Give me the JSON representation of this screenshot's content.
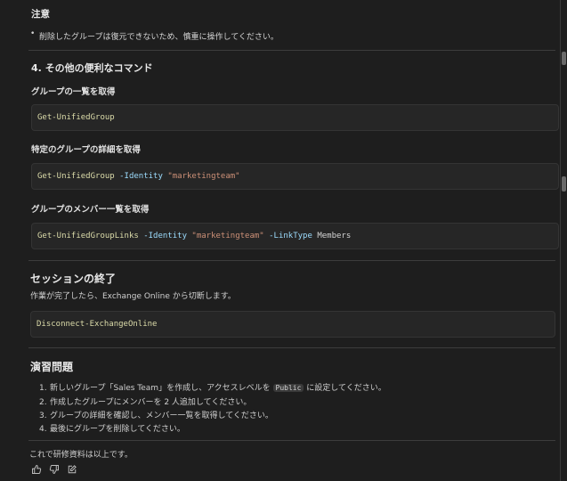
{
  "note": {
    "title": "注意",
    "bullet": "削除したグループは復元できないため、慎重に操作してください。"
  },
  "section4": {
    "heading": "4. その他の便利なコマンド",
    "list_heading": "グループの一覧を取得",
    "list_code": {
      "cmd": "Get-UnifiedGroup"
    },
    "detail_heading": "特定のグループの詳細を取得",
    "detail_code": {
      "cmd": "Get-UnifiedGroup",
      "param": "-Identity",
      "value": "\"marketingteam\""
    },
    "members_heading": "グループのメンバー一覧を取得",
    "members_code": {
      "cmd": "Get-UnifiedGroupLinks",
      "param": "-Identity",
      "value": "\"marketingteam\"",
      "param2": "-LinkType",
      "value2": "Members"
    }
  },
  "session_end": {
    "heading": "セッションの終了",
    "text": "作業が完了したら、Exchange Online から切断します。",
    "code": {
      "cmd": "Disconnect-ExchangeOnline"
    }
  },
  "exercises": {
    "heading": "演習問題",
    "items": [
      {
        "num": "1.",
        "text_before": "新しいグループ「Sales Team」を作成し、アクセスレベルを",
        "code": "Public",
        "text_after": "に設定してください。"
      },
      {
        "num": "2.",
        "text": "作成したグループにメンバーを 2 人追加してください。"
      },
      {
        "num": "3.",
        "text": "グループの詳細を確認し、メンバー一覧を取得してください。"
      },
      {
        "num": "4.",
        "text": "最後にグループを削除してください。"
      }
    ]
  },
  "footer": {
    "text": "これで研修資料は以上です。",
    "actions": [
      "thumbs-up-icon",
      "thumbs-down-icon",
      "edit-icon"
    ]
  }
}
